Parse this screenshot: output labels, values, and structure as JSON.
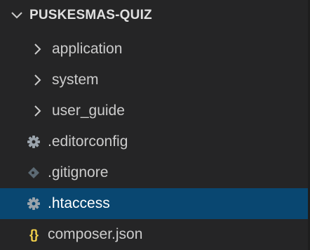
{
  "explorer": {
    "root": {
      "label": "PUSKESMAS-QUIZ",
      "icon": "chevron-down-icon"
    },
    "items": [
      {
        "label": "application",
        "kind": "folder",
        "icon": "chevron-right-icon"
      },
      {
        "label": "system",
        "kind": "folder",
        "icon": "chevron-right-icon"
      },
      {
        "label": "user_guide",
        "kind": "folder",
        "icon": "chevron-right-icon"
      },
      {
        "label": ".editorconfig",
        "kind": "file",
        "icon": "gear-icon"
      },
      {
        "label": ".gitignore",
        "kind": "file",
        "icon": "git-diamond-icon"
      },
      {
        "label": ".htaccess",
        "kind": "file",
        "icon": "gear-icon",
        "selected": true
      },
      {
        "label": "composer.json",
        "kind": "file",
        "icon": "json-braces-icon",
        "glyph": "{}"
      }
    ]
  },
  "colors": {
    "background": "#252526",
    "selection": "#094771",
    "text": "#cccccc",
    "json_icon": "#f1d04b",
    "gear_icon": "#9aa3ab",
    "git_icon": "#5c6a74"
  }
}
